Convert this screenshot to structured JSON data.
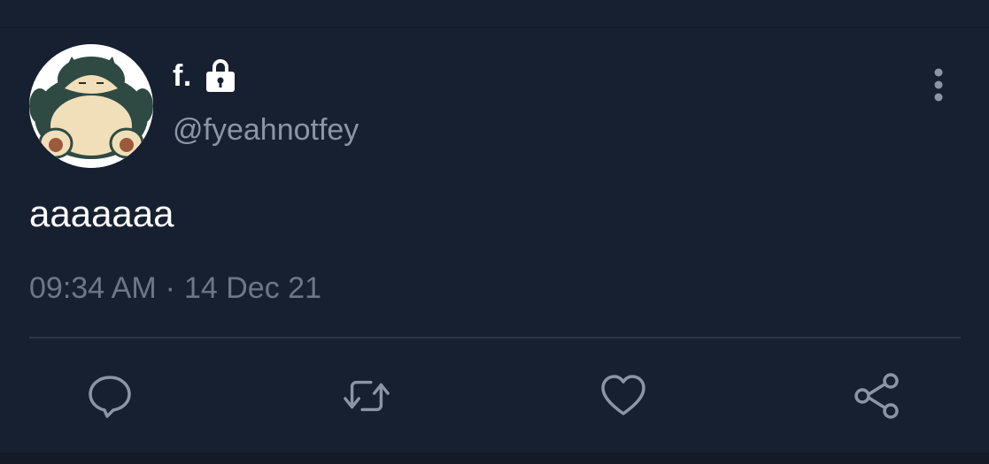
{
  "tweet": {
    "author": {
      "display_name": "f.",
      "handle": "@fyeahnotfey",
      "protected_icon": "lock-icon",
      "avatar_icon": "snorlax-avatar"
    },
    "text": "aaaaaaa",
    "time": "09:34 AM",
    "separator": "·",
    "date": "14 Dec 21"
  },
  "actions": [
    {
      "name": "reply",
      "icon": "speech-bubble-icon"
    },
    {
      "name": "retweet",
      "icon": "retweet-icon"
    },
    {
      "name": "like",
      "icon": "heart-icon"
    },
    {
      "name": "share",
      "icon": "share-icon"
    }
  ],
  "colors": {
    "background": "#172030",
    "text_primary": "#ffffff",
    "text_secondary": "#8a96a6",
    "icon": "#8a96a6",
    "divider": "#2c3647"
  }
}
